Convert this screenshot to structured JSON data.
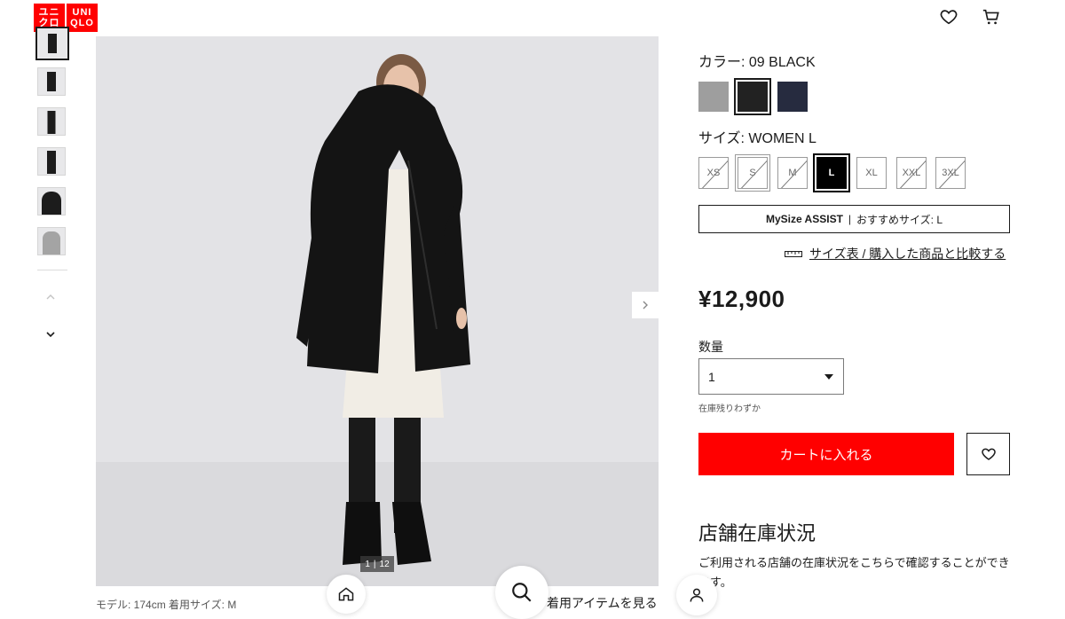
{
  "brand": {
    "line1": "ユニ",
    "line2": "クロ",
    "line3": "UNI",
    "line4": "QLO"
  },
  "header": {
    "wishlist_icon": "heart-icon",
    "cart_icon": "cart-icon"
  },
  "gallery": {
    "counter_current": "1",
    "counter_sep": "|",
    "counter_total": "12",
    "model_info": "モデル: 174cm 着用サイズ: M"
  },
  "product": {
    "color_label": "カラー:",
    "color_value": "09 BLACK",
    "colors": [
      {
        "name": "gray",
        "hex": "#9e9e9e"
      },
      {
        "name": "black",
        "hex": "#222222"
      },
      {
        "name": "navy",
        "hex": "#262b3f"
      }
    ],
    "size_label": "サイズ:",
    "size_value": "WOMEN L",
    "sizes": [
      "XS",
      "S",
      "M",
      "L",
      "XL",
      "XXL",
      "3XL"
    ],
    "mysize_brand": "MySize ASSIST",
    "mysize_divider": "|",
    "mysize_recommend": "おすすめサイズ: L",
    "size_chart_link": "サイズ表 / 購入した商品と比較する",
    "price": "¥12,900",
    "quantity_label": "数量",
    "quantity_value": "1",
    "stock_note": "在庫残りわずか",
    "add_to_cart": "カートに入れる"
  },
  "store": {
    "title": "店舗在庫状況",
    "description": "ご利用される店舗の在庫状況をこちらで確認することができます。"
  },
  "bottom_nav": {
    "outfit_link": "着用アイテムを見る"
  },
  "colors": {
    "accent": "#ff0000",
    "text": "#1b1b1b"
  }
}
